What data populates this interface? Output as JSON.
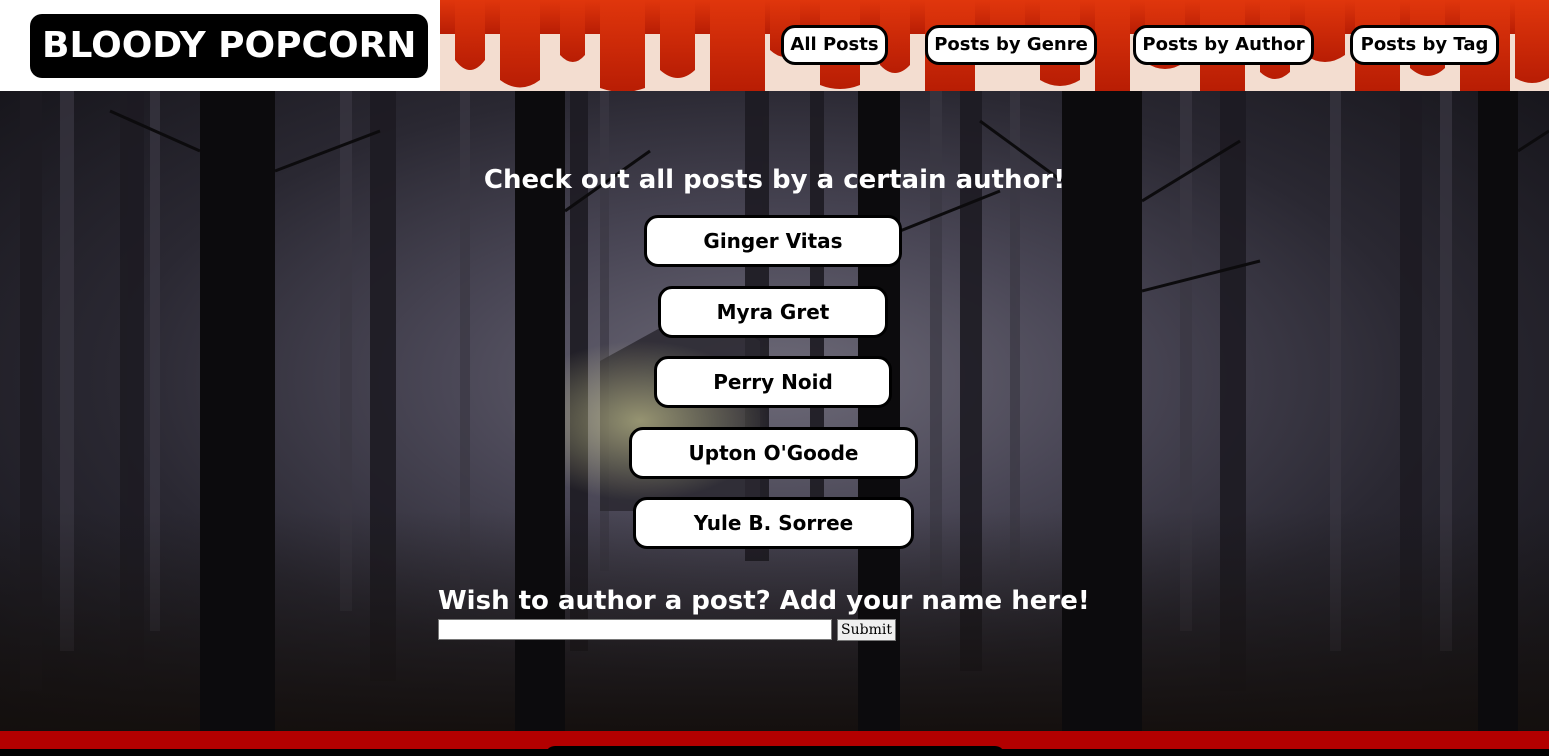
{
  "header": {
    "logo": "BLOODY POPCORN",
    "nav": [
      {
        "label": "All Posts"
      },
      {
        "label": "Posts by Genre"
      },
      {
        "label": "Posts by Author"
      },
      {
        "label": "Posts by Tag"
      }
    ]
  },
  "main": {
    "heading": "Check out all posts by a certain author!",
    "authors": [
      {
        "name": "Ginger Vitas"
      },
      {
        "name": "Myra Gret"
      },
      {
        "name": "Perry Noid"
      },
      {
        "name": "Upton O'Goode"
      },
      {
        "name": "Yule B. Sorree"
      }
    ],
    "form": {
      "prompt": "Wish to author a post? Add your name here!",
      "input_value": "",
      "submit_label": "Submit"
    }
  },
  "colors": {
    "blood": "#d42a0a",
    "footer": "#b30000",
    "button_bg": "#ffffff",
    "button_border": "#000000"
  }
}
